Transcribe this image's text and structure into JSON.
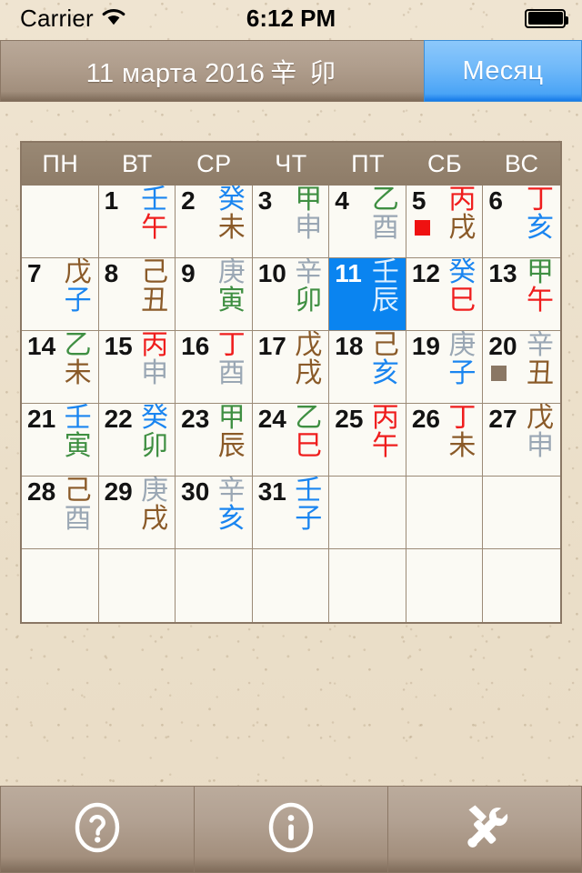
{
  "status_bar": {
    "carrier": "Carrier",
    "wifi_icon": "wifi-icon",
    "time": "6:12 PM",
    "battery_icon": "battery-full-icon"
  },
  "header": {
    "title_date": "11 марта 2016",
    "title_ganzhi": "辛 卯",
    "month_tab_label": "Месяц",
    "segment_accent_color": "#4aa4f6",
    "segment_base_color": "#a28f7d"
  },
  "calendar": {
    "weekday_headers": [
      "ПН",
      "ВТ",
      "СР",
      "ЧТ",
      "ПТ",
      "СБ",
      "ВС"
    ],
    "header_bg_color": "#8e7c68",
    "cell_bg_color": "#fbfaf4",
    "grid_line_color": "#9b8a76",
    "selected_bg_color": "#0a84f0",
    "element_colors": {
      "wood": "#3f8f42",
      "fire": "#ef1d1d",
      "earth": "#8a5a28",
      "metal": "#9aa7b4",
      "water": "#1a85f0"
    },
    "weeks": [
      [
        {
          "day": "",
          "stem": "",
          "branch": ""
        },
        {
          "day": "1",
          "stem": "壬",
          "stem_el": "water",
          "branch": "午",
          "branch_el": "fire"
        },
        {
          "day": "2",
          "stem": "癸",
          "stem_el": "water",
          "branch": "未",
          "branch_el": "earth"
        },
        {
          "day": "3",
          "stem": "甲",
          "stem_el": "wood",
          "branch": "申",
          "branch_el": "metal"
        },
        {
          "day": "4",
          "stem": "乙",
          "stem_el": "wood",
          "branch": "酉",
          "branch_el": "metal"
        },
        {
          "day": "5",
          "stem": "丙",
          "stem_el": "fire",
          "branch": "戌",
          "branch_el": "earth",
          "marker": "#ef1111"
        },
        {
          "day": "6",
          "stem": "丁",
          "stem_el": "fire",
          "branch": "亥",
          "branch_el": "water"
        }
      ],
      [
        {
          "day": "7",
          "stem": "戊",
          "stem_el": "earth",
          "branch": "子",
          "branch_el": "water"
        },
        {
          "day": "8",
          "stem": "己",
          "stem_el": "earth",
          "branch": "丑",
          "branch_el": "earth"
        },
        {
          "day": "9",
          "stem": "庚",
          "stem_el": "metal",
          "branch": "寅",
          "branch_el": "wood"
        },
        {
          "day": "10",
          "stem": "辛",
          "stem_el": "metal",
          "branch": "卯",
          "branch_el": "wood"
        },
        {
          "day": "11",
          "stem": "壬",
          "stem_el": "water",
          "branch": "辰",
          "branch_el": "earth",
          "selected": true
        },
        {
          "day": "12",
          "stem": "癸",
          "stem_el": "water",
          "branch": "巳",
          "branch_el": "fire"
        },
        {
          "day": "13",
          "stem": "甲",
          "stem_el": "wood",
          "branch": "午",
          "branch_el": "fire"
        }
      ],
      [
        {
          "day": "14",
          "stem": "乙",
          "stem_el": "wood",
          "branch": "未",
          "branch_el": "earth"
        },
        {
          "day": "15",
          "stem": "丙",
          "stem_el": "fire",
          "branch": "申",
          "branch_el": "metal"
        },
        {
          "day": "16",
          "stem": "丁",
          "stem_el": "fire",
          "branch": "酉",
          "branch_el": "metal"
        },
        {
          "day": "17",
          "stem": "戊",
          "stem_el": "earth",
          "branch": "戌",
          "branch_el": "earth"
        },
        {
          "day": "18",
          "stem": "己",
          "stem_el": "earth",
          "branch": "亥",
          "branch_el": "water"
        },
        {
          "day": "19",
          "stem": "庚",
          "stem_el": "metal",
          "branch": "子",
          "branch_el": "water"
        },
        {
          "day": "20",
          "stem": "辛",
          "stem_el": "metal",
          "branch": "丑",
          "branch_el": "earth",
          "marker": "#8a7764"
        }
      ],
      [
        {
          "day": "21",
          "stem": "壬",
          "stem_el": "water",
          "branch": "寅",
          "branch_el": "wood"
        },
        {
          "day": "22",
          "stem": "癸",
          "stem_el": "water",
          "branch": "卯",
          "branch_el": "wood"
        },
        {
          "day": "23",
          "stem": "甲",
          "stem_el": "wood",
          "branch": "辰",
          "branch_el": "earth"
        },
        {
          "day": "24",
          "stem": "乙",
          "stem_el": "wood",
          "branch": "巳",
          "branch_el": "fire"
        },
        {
          "day": "25",
          "stem": "丙",
          "stem_el": "fire",
          "branch": "午",
          "branch_el": "fire"
        },
        {
          "day": "26",
          "stem": "丁",
          "stem_el": "fire",
          "branch": "未",
          "branch_el": "earth"
        },
        {
          "day": "27",
          "stem": "戊",
          "stem_el": "earth",
          "branch": "申",
          "branch_el": "metal"
        }
      ],
      [
        {
          "day": "28",
          "stem": "己",
          "stem_el": "earth",
          "branch": "酉",
          "branch_el": "metal"
        },
        {
          "day": "29",
          "stem": "庚",
          "stem_el": "metal",
          "branch": "戌",
          "branch_el": "earth"
        },
        {
          "day": "30",
          "stem": "辛",
          "stem_el": "metal",
          "branch": "亥",
          "branch_el": "water"
        },
        {
          "day": "31",
          "stem": "壬",
          "stem_el": "water",
          "branch": "子",
          "branch_el": "water"
        },
        {
          "day": "",
          "stem": "",
          "branch": ""
        },
        {
          "day": "",
          "stem": "",
          "branch": ""
        },
        {
          "day": "",
          "stem": "",
          "branch": ""
        }
      ],
      [
        {
          "day": "",
          "stem": "",
          "branch": ""
        },
        {
          "day": "",
          "stem": "",
          "branch": ""
        },
        {
          "day": "",
          "stem": "",
          "branch": ""
        },
        {
          "day": "",
          "stem": "",
          "branch": ""
        },
        {
          "day": "",
          "stem": "",
          "branch": ""
        },
        {
          "day": "",
          "stem": "",
          "branch": ""
        },
        {
          "day": "",
          "stem": "",
          "branch": ""
        }
      ]
    ]
  },
  "toolbar": {
    "buttons": [
      {
        "name": "help-button",
        "icon": "question-circle-icon"
      },
      {
        "name": "info-button",
        "icon": "info-circle-icon"
      },
      {
        "name": "tools-button",
        "icon": "hammer-wrench-icon"
      }
    ]
  }
}
